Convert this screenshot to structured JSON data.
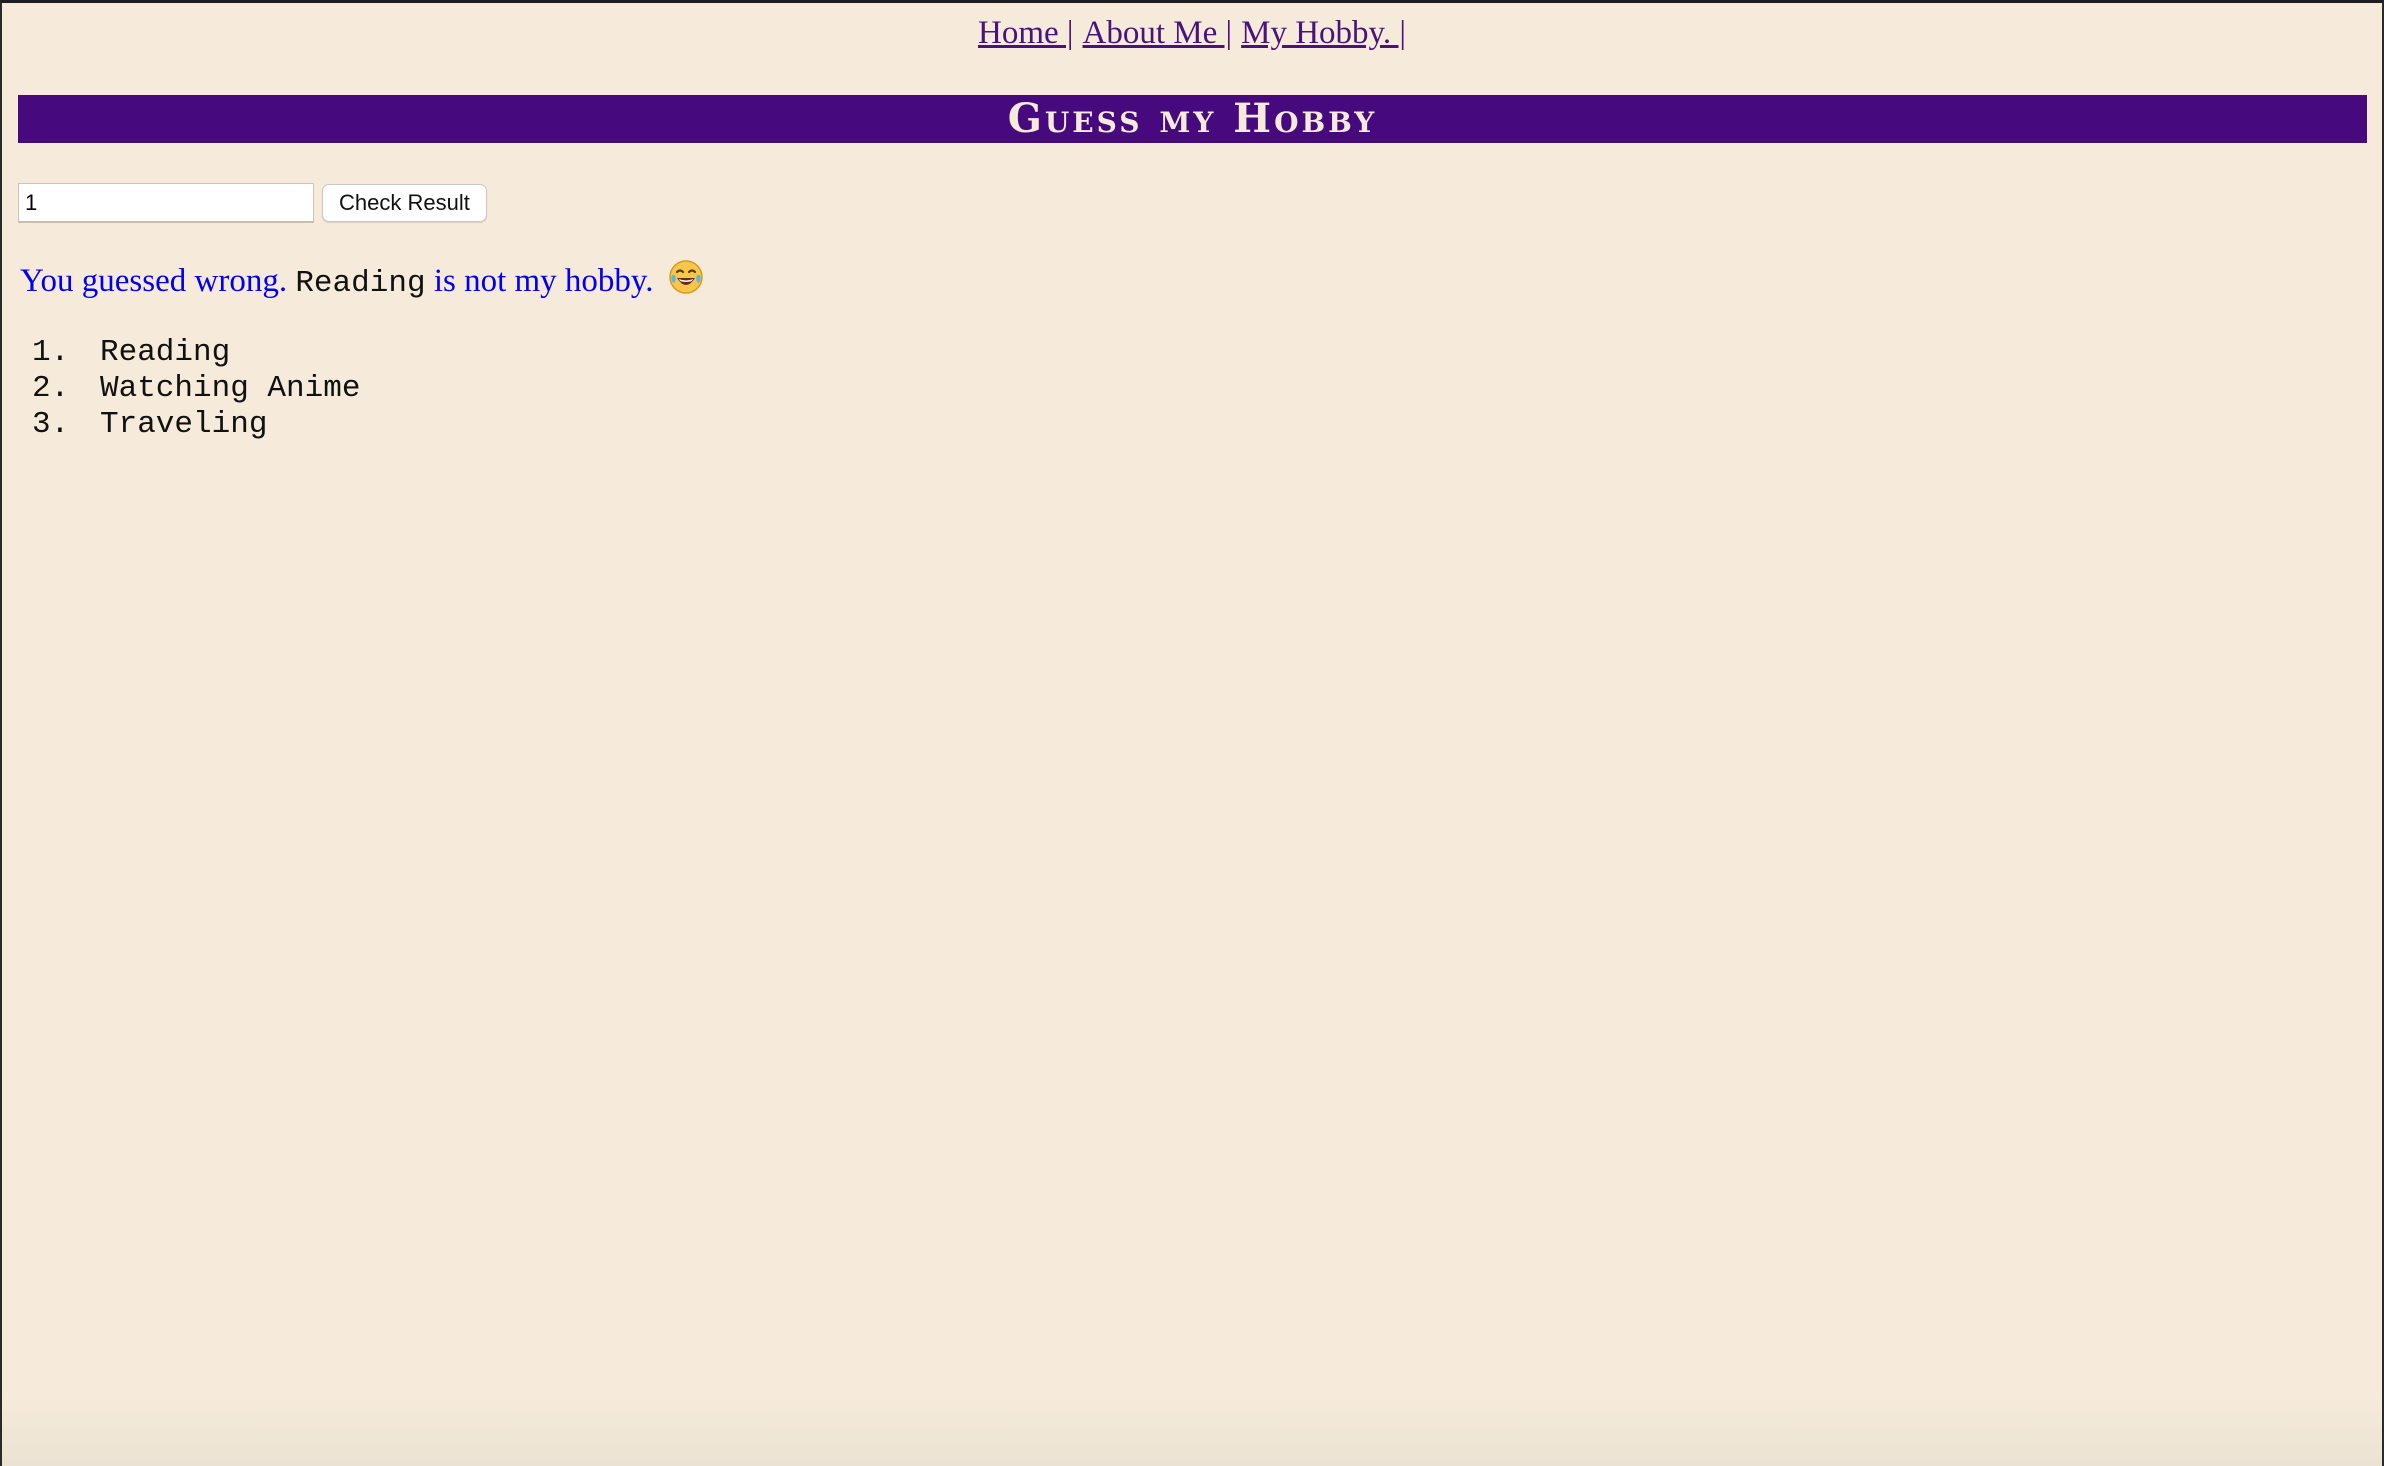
{
  "nav": {
    "items": [
      {
        "label": "Home |"
      },
      {
        "label": "About Me |"
      },
      {
        "label": "My Hobby. |"
      }
    ]
  },
  "banner": {
    "title": "Guess my Hobby"
  },
  "form": {
    "input_value": "1",
    "button_label": "Check Result"
  },
  "result": {
    "prefix": "You guessed wrong.",
    "hobby": "Reading",
    "suffix": "is not my hobby.",
    "emoji": "😂",
    "emoji_icon": "laughing-tears-emoji-icon"
  },
  "hobbies": [
    {
      "number": "1.",
      "name": "Reading"
    },
    {
      "number": "2.",
      "name": "Watching Anime"
    },
    {
      "number": "3.",
      "name": "Traveling"
    }
  ],
  "colors": {
    "background": "#f6ebda",
    "banner": "#460a7e",
    "link": "#47137c",
    "result_text": "#0000ee"
  }
}
